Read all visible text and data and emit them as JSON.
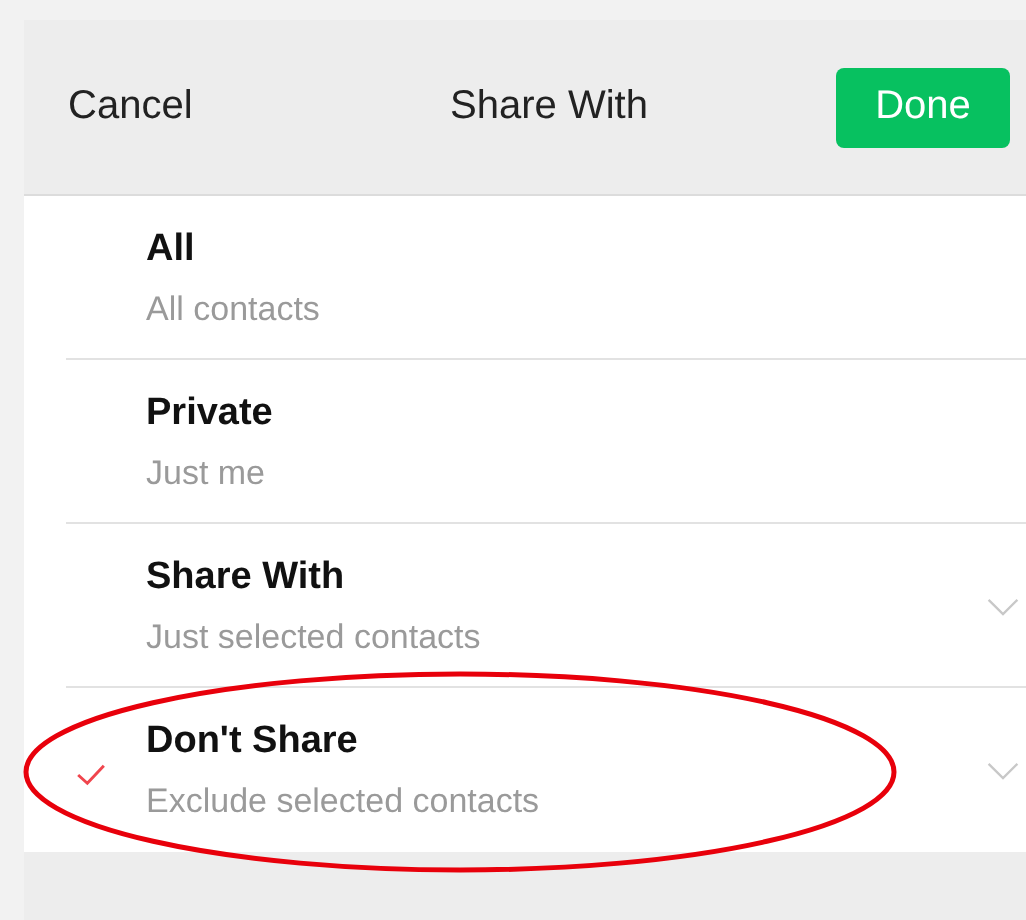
{
  "header": {
    "cancel": "Cancel",
    "title": "Share With",
    "done": "Done"
  },
  "options": [
    {
      "title": "All",
      "subtitle": "All contacts",
      "selected": false,
      "expandable": false,
      "circled": false
    },
    {
      "title": "Private",
      "subtitle": "Just me",
      "selected": false,
      "expandable": false,
      "circled": false
    },
    {
      "title": "Share With",
      "subtitle": "Just selected contacts",
      "selected": false,
      "expandable": true,
      "circled": false
    },
    {
      "title": "Don't Share",
      "subtitle": "Exclude selected contacts",
      "selected": true,
      "expandable": true,
      "circled": true
    }
  ]
}
